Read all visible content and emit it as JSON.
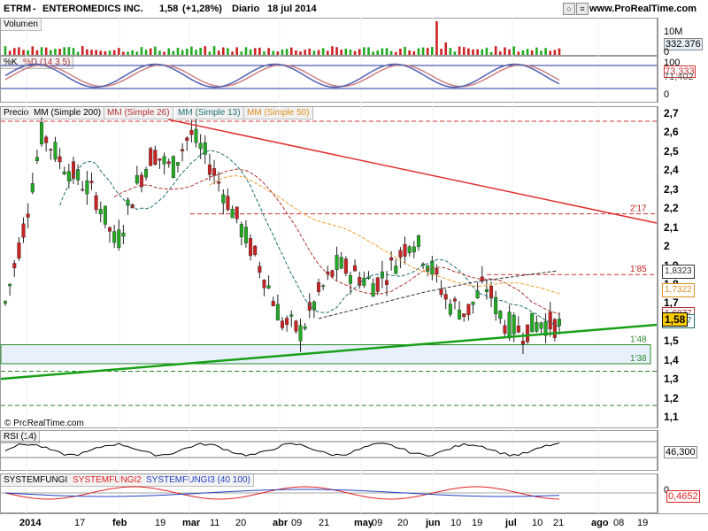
{
  "header": {
    "ticker": "ETRM",
    "company": "ENTEROMEDICS INC.",
    "price": "1,58",
    "change": "(+1,28%)",
    "period": "Diario",
    "date": "18 jul 2014",
    "site": "www.ProRealTime.com"
  },
  "panels": {
    "volume": {
      "label": "Volumen",
      "scale_top": "10M",
      "last": "332.376",
      "zero": "0"
    },
    "stoch": {
      "label_k": "%K",
      "label_d": "%D (14 3 5)",
      "v1": "100",
      "v2": "73,333",
      "v3": "71,402",
      "v4": "0"
    },
    "price": {
      "label": "Precio",
      "mm200": "MM (Simple 200)",
      "mm26": "MM (Simple 26)",
      "mm13": "MM (Simple 13)",
      "mm50": "MM (Simple 50)",
      "copyright": "© ProRealTime.com"
    },
    "rsi": {
      "label": "RSI (14)",
      "value": "46,300"
    },
    "sys": {
      "l1": "SYSTEMFUNGI",
      "l2": "SYSTEMFUNGI2",
      "l3": "SYSTEMFUNGI3 (40 100)",
      "zero": "0",
      "value": "0,4652"
    }
  },
  "price_axis": {
    "ticks": [
      "2,7",
      "2,6",
      "2,5",
      "2,4",
      "2,3",
      "2,2",
      "2,1",
      "2",
      "1,9",
      "1,8",
      "1,7",
      "1,6",
      "1,5",
      "1,4",
      "1,3",
      "1,2",
      "1,1"
    ]
  },
  "price_tags": {
    "r217": "2'17",
    "r185": "1'85",
    "s148": "1'48",
    "s138": "1'38"
  },
  "axis_boxes": {
    "b1": "1,8323",
    "b2": "1,7322",
    "b3": "1,6077",
    "b4": "1,5877",
    "last": "1,58"
  },
  "x_axis": [
    "2014",
    "17",
    "feb",
    "19",
    "mar",
    "11",
    "20",
    "abr",
    "09",
    "21",
    "may",
    "09",
    "20",
    "jun",
    "10",
    "19",
    "jul",
    "10",
    "21",
    "ago",
    "08",
    "19"
  ],
  "colors": {
    "up": "#22aa22",
    "down": "#cc2222",
    "mm200": "#333333",
    "mm26": "#b03030",
    "mm13": "#207070",
    "mm50": "#f0a030",
    "trend_red": "#e03030",
    "trend_green": "#18a018",
    "rsi": "#000000",
    "sys2": "#e02020",
    "sys3": "#2040c0"
  },
  "chart_data": {
    "type": "candlestick",
    "title": "ETRM - ENTEROMEDICS INC.",
    "ylim": [
      1.05,
      2.75
    ],
    "x": [
      "2014",
      "17",
      "feb",
      "19",
      "mar",
      "11",
      "20",
      "abr",
      "09",
      "21",
      "may",
      "09",
      "20",
      "jun",
      "10",
      "19",
      "jul",
      "10",
      "21"
    ],
    "closes": [
      1.7,
      2.1,
      2.6,
      2.45,
      2.35,
      2.25,
      2.0,
      2.3,
      2.5,
      2.4,
      2.6,
      2.45,
      2.25,
      2.05,
      1.85,
      1.6,
      1.55,
      1.75,
      1.9,
      1.85,
      1.8,
      1.9,
      2.05,
      1.9,
      1.7,
      1.65,
      1.8,
      1.6,
      1.55,
      1.6,
      1.58
    ],
    "levels": {
      "resistance_217": 2.17,
      "resistance_185": 1.85,
      "support_148": 1.48,
      "support_138": 1.38
    },
    "last": 1.58
  }
}
